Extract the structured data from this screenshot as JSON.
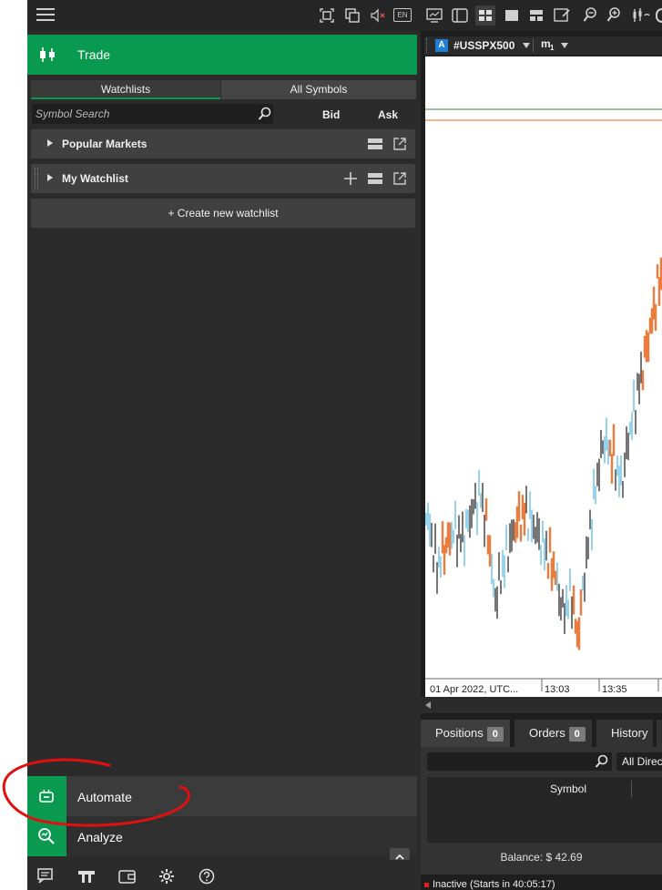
{
  "left_panel": {
    "topbar": {
      "language": "EN"
    },
    "trade": {
      "label": "Trade"
    },
    "tabs": [
      {
        "label": "Watchlists"
      },
      {
        "label": "All Symbols"
      }
    ],
    "search": {
      "placeholder": "Symbol Search"
    },
    "columns": {
      "bid": "Bid",
      "ask": "Ask"
    },
    "watchlists": [
      {
        "label": "Popular Markets"
      },
      {
        "label": "My Watchlist"
      }
    ],
    "create_label": "+ Create new watchlist",
    "automate": {
      "label": "Automate"
    },
    "analyze": {
      "label": "Analyze"
    }
  },
  "chart_panel": {
    "symbol_badge": "A",
    "symbol": "#USSPX500",
    "timeframe": "m",
    "timeframe_sub": "1",
    "x_labels": [
      "01 Apr 2022, UTC...",
      "13:03",
      "13:35"
    ],
    "colors": {
      "up": "#4db6e6",
      "down": "#1a1a1a",
      "highlight": "#f07a3c",
      "line_green": "#2e8b3a",
      "line_orange": "#e06a20"
    }
  },
  "bottom_panel": {
    "tabs": [
      {
        "label": "Positions",
        "count": "0"
      },
      {
        "label": "Orders",
        "count": "0"
      },
      {
        "label": "History"
      }
    ],
    "direction_filter": "All Direc",
    "table_header": "Symbol",
    "balance": "Balance: $ 42.69",
    "status": "Inactive (Starts in 40:05:17)"
  },
  "chart_data": {
    "type": "line",
    "x": [
      "01 Apr 2022, UTC...",
      "13:03",
      "13:35"
    ],
    "series": [],
    "note_visible": false
  }
}
